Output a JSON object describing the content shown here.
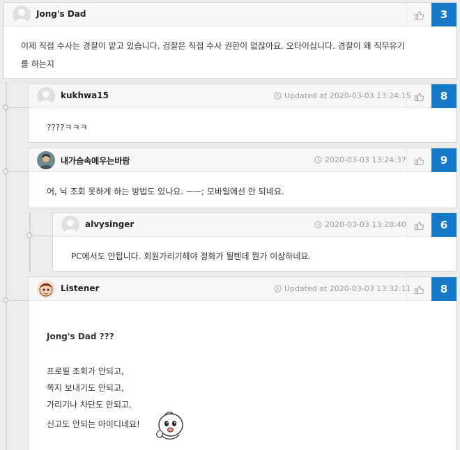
{
  "comments": [
    {
      "author": "Jong's Dad",
      "meta": "",
      "votes": "3",
      "body": [
        "이제 직접 수사는 경찰이 맡고 있습니다. 검찰은 직접 수사 권한이 없잖아요. 오타이십니다. 경찰이 왜 직무유기",
        "를 하는지"
      ]
    },
    {
      "author": "kukhwa15",
      "meta": "Updated at 2020-03-03 13:24:15",
      "votes": "8",
      "body": [
        "????ㅋㅋㅋ"
      ]
    },
    {
      "author": "내가슴속에우는바람",
      "meta": "2020-03-03 13:24:37",
      "votes": "9",
      "body": [
        "어, 닉 조회 못하게 하는 방법도 있나요. ㅡㅡ; 모바일에선 안 되네요."
      ]
    },
    {
      "author": "alvysinger",
      "meta": "2020-03-03 13:28:40",
      "votes": "6",
      "body": [
        "PC에서도 안됩니다. 회원가리기해야 정화가 될텐데 뭔가 이상하네요."
      ]
    },
    {
      "author": "Listener",
      "meta": "Updated at 2020-03-03 13:32:11",
      "votes": "8",
      "body": [
        "Jong's Dad ???",
        "프로필 조회가 안되고,",
        "쪽지 보내기도 안되고,",
        "가리기나 차단도 안되고,",
        "신고도 안되는 아이디네요!"
      ]
    }
  ],
  "icons": {
    "like": "thumbs-up-icon",
    "clock": "clock-icon"
  },
  "colors": {
    "vote_badge": "#1479c7",
    "header_bg": "#f7f7f7",
    "page_bg": "#ececec"
  }
}
